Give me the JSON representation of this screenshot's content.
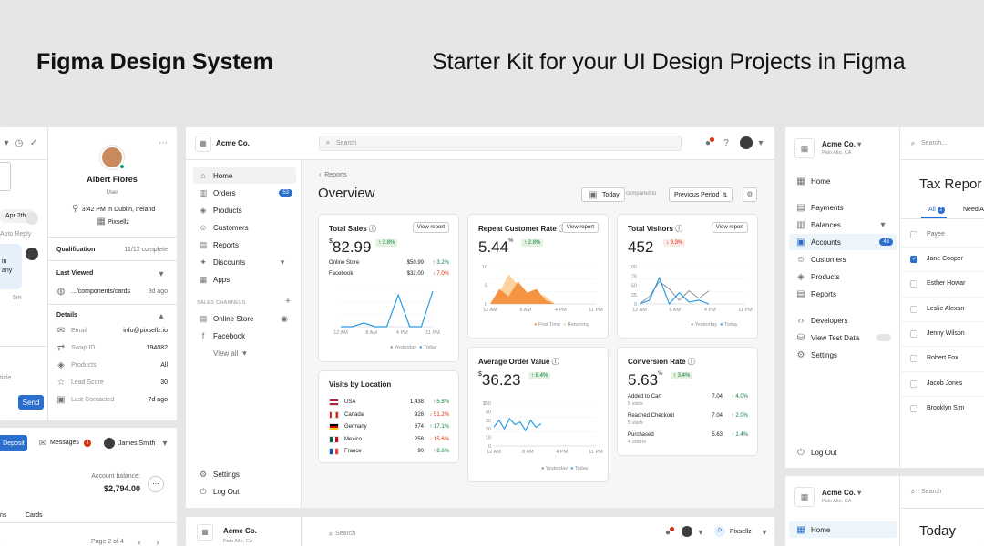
{
  "hero": {
    "left": "Figma Design System",
    "right": "Starter Kit for your UI Design Projects in Figma"
  },
  "left_panel": {
    "date_chip": "Apr 2th,",
    "auto_reply": "Auto Reply",
    "msg_line1": "in",
    "msg_line2": "any",
    "msg_time": "5m",
    "article": "ticle",
    "send": "Send",
    "profile": {
      "name": "Albert Flores",
      "role": "User",
      "time_location": "3:42 PM in Dublin, Ireland",
      "company": "Pixsellz"
    },
    "qualification": {
      "label": "Qualification",
      "value": "11/12 complete"
    },
    "last_viewed": {
      "label": "Last Viewed",
      "path": ".../components/cards",
      "ago": "9d ago"
    },
    "details": {
      "label": "Details",
      "rows": [
        {
          "k": "Email",
          "v": "info@pixsellz.io"
        },
        {
          "k": "Swap ID",
          "v": "194082"
        },
        {
          "k": "Products",
          "v": "All"
        },
        {
          "k": "Lead Score",
          "v": "30"
        },
        {
          "k": "Last Contacted",
          "v": "7d ago"
        }
      ]
    }
  },
  "left_bottom": {
    "deposit": "Deposit",
    "messages": "Messages",
    "messages_count": "3",
    "user": "James Smith",
    "balance_label": "Account balance:",
    "balance": "$2,794.00",
    "tab1": "ns",
    "tab2": "Cards",
    "page": "Page 2 of 4"
  },
  "dash": {
    "store": "Acme Co.",
    "search_placeholder": "Search",
    "nav": [
      {
        "label": "Home",
        "icon": "home-icon"
      },
      {
        "label": "Orders",
        "icon": "orders-icon",
        "badge": "53"
      },
      {
        "label": "Products",
        "icon": "tag-icon"
      },
      {
        "label": "Customers",
        "icon": "person-icon"
      },
      {
        "label": "Reports",
        "icon": "chart-icon"
      },
      {
        "label": "Discounts",
        "icon": "discount-icon"
      },
      {
        "label": "Apps",
        "icon": "apps-icon"
      }
    ],
    "sales_channels": "SALES CHANNELS",
    "channels": [
      {
        "label": "Online Store"
      },
      {
        "label": "Facebook"
      }
    ],
    "view_all": "View all",
    "settings": "Settings",
    "logout": "Log Out",
    "breadcrumb": "Reports",
    "title": "Overview",
    "today": "Today",
    "compared_to": "compared to",
    "previous_period": "Previous Period",
    "total_sales": {
      "title": "Total Sales",
      "button": "View report",
      "value": "82.99",
      "change": "2.8%",
      "rows": [
        {
          "name": "Online Store",
          "amount": "$50.99",
          "change": "3.2%",
          "dir": "up"
        },
        {
          "name": "Facebook",
          "amount": "$32.00",
          "change": "7.0%",
          "dir": "down"
        }
      ],
      "x_ticks": [
        "12 AM",
        "8 AM",
        "4 PM",
        "11 PM"
      ],
      "legend": [
        "Yesterday",
        "Today"
      ]
    },
    "repeat_customer": {
      "title": "Repeat Customer Rate",
      "button": "View report",
      "value": "5.44",
      "unit": "%",
      "change": "2.8%",
      "y_ticks": [
        "10",
        "5",
        "0"
      ],
      "x_ticks": [
        "12 AM",
        "8 AM",
        "4 PM",
        "11 PM"
      ],
      "legend": [
        "First Time",
        "Returning"
      ]
    },
    "total_visitors": {
      "title": "Total Visitors",
      "button": "View report",
      "value": "452",
      "change": "9.3%",
      "y_ticks": [
        "100",
        "75",
        "50",
        "25",
        "0"
      ],
      "x_ticks": [
        "12 AM",
        "8 AM",
        "4 PM",
        "11 PM"
      ],
      "legend": [
        "Yesterday",
        "Today"
      ]
    },
    "visits_location": {
      "title": "Visits by Location",
      "rows": [
        {
          "country": "USA",
          "count": "1,438",
          "change": "5.8%",
          "dir": "up"
        },
        {
          "country": "Canada",
          "count": "928",
          "change": "51.2%",
          "dir": "down"
        },
        {
          "country": "Germany",
          "count": "674",
          "change": "17.1%",
          "dir": "up"
        },
        {
          "country": "Mexico",
          "count": "258",
          "change": "15.6%",
          "dir": "down"
        },
        {
          "country": "France",
          "count": "90",
          "change": "8.6%",
          "dir": "up"
        }
      ]
    },
    "avg_order": {
      "title": "Average Order Value",
      "value": "36.23",
      "change": "8.4%",
      "y_ticks": [
        "$50",
        "40",
        "30",
        "20",
        "10",
        "0"
      ],
      "x_ticks": [
        "12 AM",
        "8 AM",
        "4 PM",
        "11 PM"
      ],
      "legend": [
        "Yesterday",
        "Today"
      ]
    },
    "conversion": {
      "title": "Conversion Rate",
      "value": "5.63",
      "unit": "%",
      "change": "3.4%",
      "rows": [
        {
          "name": "Added to Cart",
          "sub": "5 visits",
          "pct": "7.04",
          "change": "4.0%"
        },
        {
          "name": "Reached Checkout",
          "sub": "5 visits",
          "pct": "7.04",
          "change": "2.0%"
        },
        {
          "name": "Purchased",
          "sub": "4 orders",
          "pct": "5.63",
          "change": "1.4%"
        }
      ]
    }
  },
  "right_top": {
    "store": "Acme Co.",
    "location": "Palo Alto, CA",
    "search_placeholder": "Search...",
    "nav": [
      {
        "label": "Home"
      },
      {
        "label": "Payments"
      },
      {
        "label": "Balances"
      },
      {
        "label": "Accounts",
        "badge": "43"
      },
      {
        "label": "Customers"
      },
      {
        "label": "Products"
      },
      {
        "label": "Reports"
      },
      {
        "label": "Developers"
      },
      {
        "label": "View Test Data"
      },
      {
        "label": "Settings"
      }
    ],
    "logout": "Log Out",
    "title": "Tax Repor",
    "tab_all": "All",
    "tab_need": "Need A",
    "col_payee": "Payee",
    "payees": [
      "Jane Cooper",
      "Esther Howar",
      "Leslie Alexan",
      "Jenny Wilson",
      "Robert Fox",
      "Jacob Jones",
      "Brooklyn Sim"
    ]
  },
  "right_bottom": {
    "store": "Acme Co.",
    "location": "Palo Alto, CA",
    "search": "Search",
    "home": "Home",
    "today": "Today"
  },
  "dash2": {
    "store": "Acme Co.",
    "location": "Palo Alto, CA",
    "search": "Search",
    "user": "Pixsellz"
  },
  "chart_data": [
    {
      "type": "line",
      "title": "Total Sales",
      "x": [
        "12 AM",
        "8 AM",
        "4 PM",
        "11 PM"
      ],
      "series": [
        {
          "name": "Today",
          "values": [
            0,
            0,
            0.1,
            0,
            0,
            0.85,
            0,
            0,
            0.95
          ]
        }
      ]
    },
    {
      "type": "area",
      "title": "Repeat Customer Rate",
      "x": [
        "12 AM",
        "8 AM",
        "4 PM",
        "11 PM"
      ],
      "ylim": [
        0,
        10
      ],
      "series": [
        {
          "name": "First Time",
          "values": [
            0,
            4,
            2,
            6,
            3,
            4,
            1,
            0
          ]
        },
        {
          "name": "Returning",
          "values": [
            0,
            3,
            8,
            5,
            2,
            3,
            2,
            0
          ]
        }
      ]
    },
    {
      "type": "line",
      "title": "Total Visitors",
      "x": [
        "12 AM",
        "8 AM",
        "4 PM",
        "11 PM"
      ],
      "ylim": [
        0,
        100
      ],
      "series": [
        {
          "name": "Yesterday",
          "values": [
            0,
            20,
            60,
            40,
            10,
            35,
            15,
            35
          ]
        },
        {
          "name": "Today",
          "values": [
            0,
            10,
            70,
            0,
            30,
            5,
            10,
            0
          ]
        }
      ]
    },
    {
      "type": "line",
      "title": "Average Order Value",
      "x": [
        "12 AM",
        "8 AM",
        "4 PM",
        "11 PM"
      ],
      "ylim": [
        0,
        50
      ],
      "series": [
        {
          "name": "Today",
          "values": [
            22,
            30,
            20,
            32,
            25,
            28,
            18,
            30,
            22,
            26
          ]
        }
      ]
    }
  ]
}
